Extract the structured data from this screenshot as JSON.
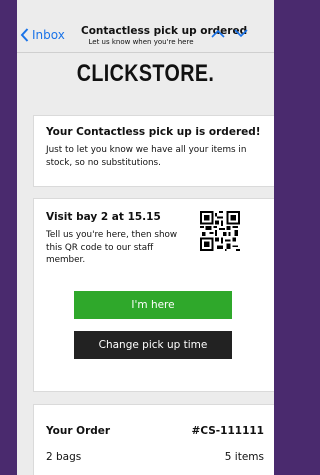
{
  "nav": {
    "back_label": "Inbox",
    "title": "Contactless pick up ordered",
    "subtitle": "Let us know when you're here"
  },
  "brand": {
    "logo": "CLICKSTORE."
  },
  "confirmation": {
    "heading": "Your Contactless pick up is ordered!",
    "body": "Just to let you know we have all your items in stock, so no substitutions."
  },
  "pickup": {
    "heading": "Visit bay 2 at 15.15",
    "body": "Tell us you're here, then show this QR code to our staff member.",
    "here_button": "I'm here",
    "change_button": "Change pick up time"
  },
  "order": {
    "title": "Your Order",
    "number": "#CS-111111",
    "bags": "2 bags",
    "items": "5 items"
  },
  "colors": {
    "accent_link": "#1a73e8",
    "primary_button": "#2fa82b",
    "secondary_button": "#222222",
    "frame": "#4a2a6e"
  }
}
